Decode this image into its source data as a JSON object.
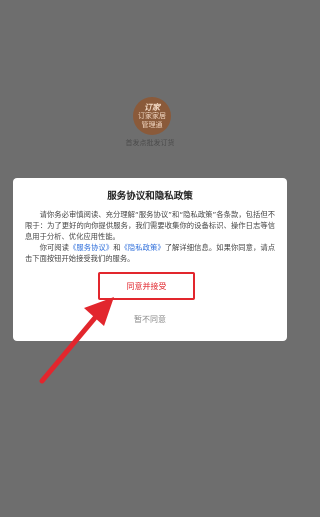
{
  "splash": {
    "logo_line1": "订家",
    "logo_line2": "订家家居",
    "logo_line3": "管理通",
    "caption": "首发点批发订货"
  },
  "dialog": {
    "title": "服务协议和隐私政策",
    "paragraph1": "请你务必审慎阅读、充分理解“服务协议”和“隐私政策”各条款，包括但不限于：为了更好的向你提供服务，我们需要收集你的设备标识、操作日志等信息用于分析、优化应用性能。",
    "paragraph2_prefix": "你可阅读",
    "service_link": "《服务协议》",
    "and": "和",
    "privacy_link": "《隐私政策》",
    "paragraph2_suffix": "了解详细信息。如果你同意，请点击下面按钮开始接受我们的服务。",
    "accept_label": "同意并接受",
    "decline_label": "暂不同意"
  },
  "colors": {
    "highlight": "#e2262d",
    "link": "#2f6fdb",
    "overlay": "#6e6e6e"
  }
}
